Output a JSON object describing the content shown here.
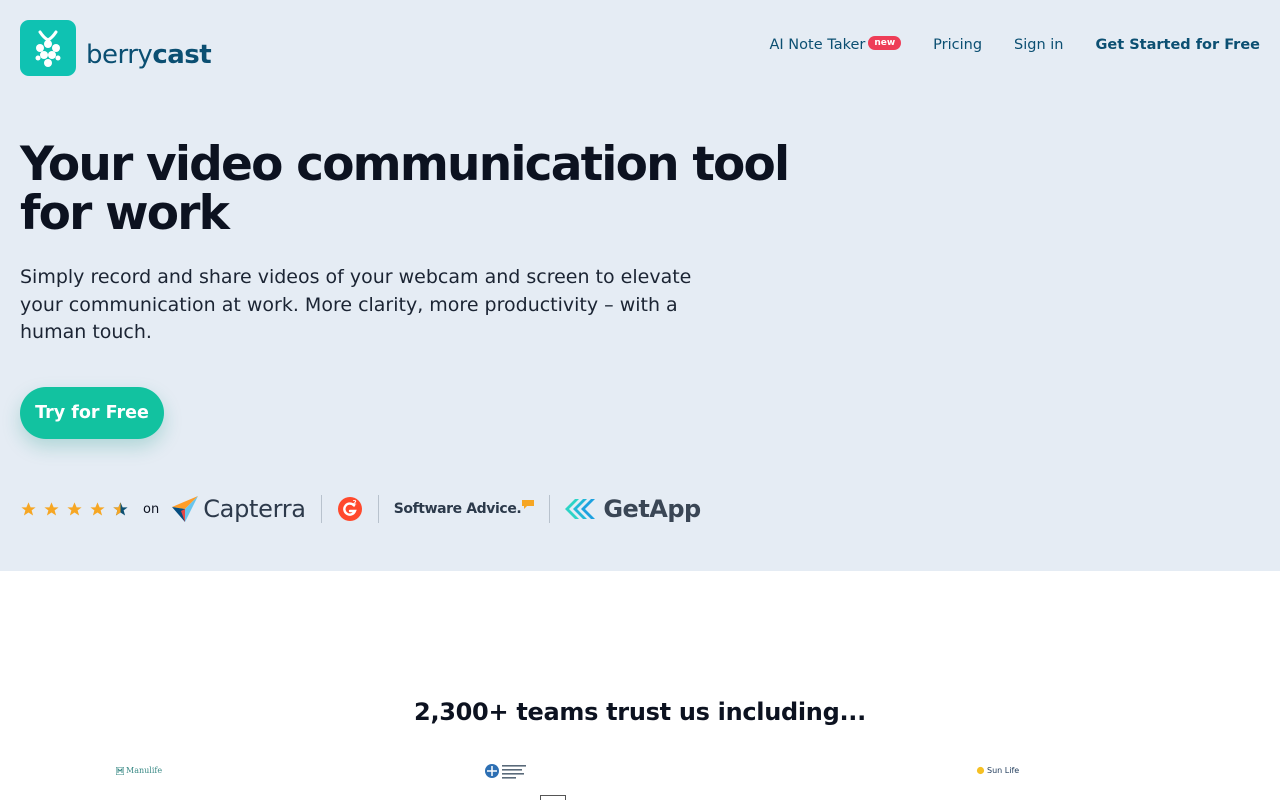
{
  "brand": {
    "name_part1": "berry",
    "name_part2": "cast",
    "accent": "#0fc2b2",
    "text_color": "#0b4f72"
  },
  "nav": {
    "items": [
      {
        "label": "AI Note Taker",
        "badge": "new"
      },
      {
        "label": "Pricing"
      },
      {
        "label": "Sign in"
      },
      {
        "label": "Get Started for Free"
      }
    ]
  },
  "hero": {
    "headline": "Your video communication tool for work",
    "subtext": "Simply record and share videos of your webcam and screen to elevate your communication at work. More clarity, more productivity – with a human touch.",
    "cta_label": "Try for Free",
    "cta_color": "#12c2a0",
    "background": "#e5ecf4"
  },
  "ratings": {
    "stars": 4.5,
    "on_label": "on",
    "platforms": [
      {
        "name": "Capterra",
        "icon": "capterra-icon"
      },
      {
        "name": "G2",
        "icon": "g2-icon"
      },
      {
        "name": "Software Advice.",
        "icon": "software-advice-icon"
      },
      {
        "name": "GetApp",
        "icon": "getapp-icon"
      }
    ]
  },
  "trust": {
    "title": "2,300+ teams trust us including...",
    "clients": [
      "Manulife",
      "Sun Life"
    ]
  }
}
